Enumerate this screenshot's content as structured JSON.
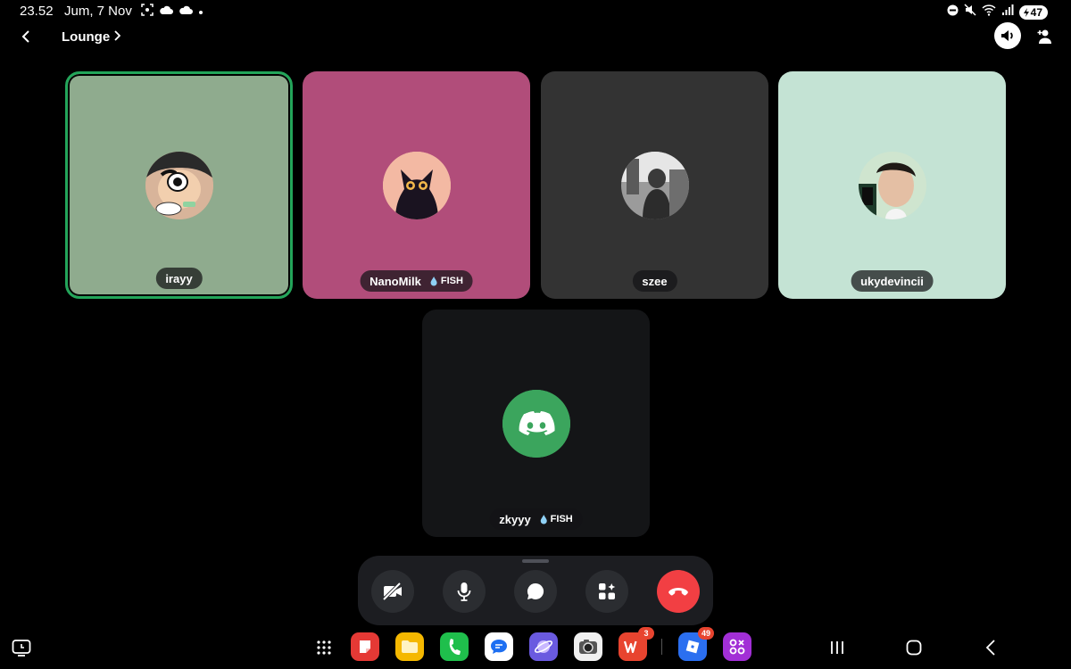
{
  "status_bar": {
    "time": "23.52",
    "date": "Jum, 7 Nov",
    "battery": "47",
    "icons": [
      "screenshot-icon",
      "cloud-icon",
      "cloud-icon",
      "dot-icon",
      "dnd-icon",
      "mute-icon",
      "wifi-icon",
      "signal-icon",
      "battery-icon"
    ]
  },
  "header": {
    "channel": "Lounge"
  },
  "participants": [
    {
      "name": "irayy",
      "tag": "",
      "tile_color": "#8fab8e",
      "speaking": true
    },
    {
      "name": "NanoMilk",
      "tag": "FISH",
      "tile_color": "#b14d7a",
      "speaking": false
    },
    {
      "name": "szee",
      "tag": "",
      "tile_color": "#333333",
      "speaking": false
    },
    {
      "name": "ukydevincii",
      "tag": "",
      "tile_color": "#c4e3d4",
      "speaking": false
    },
    {
      "name": "zkyyy",
      "tag": "FISH",
      "tile_color": "#141517",
      "speaking": false
    }
  ],
  "controls": [
    "camera-off-icon",
    "microphone-icon",
    "chat-icon",
    "activities-icon",
    "end-call-icon"
  ],
  "dock": {
    "apps": [
      {
        "name": "app-red",
        "color": "#e53935",
        "badge": ""
      },
      {
        "name": "app-files",
        "color": "#f5b800",
        "badge": ""
      },
      {
        "name": "app-phone",
        "color": "#1fbf4c",
        "badge": ""
      },
      {
        "name": "app-messages",
        "color": "#ffffff",
        "badge": ""
      },
      {
        "name": "app-browser",
        "color": "#6a5ae0",
        "badge": ""
      },
      {
        "name": "app-camera",
        "color": "#f0f0f0",
        "badge": ""
      },
      {
        "name": "app-wps",
        "color": "#e8442f",
        "badge": "3"
      },
      {
        "name": "app-roblox",
        "color": "#2b6ff0",
        "badge": "49"
      },
      {
        "name": "app-purple",
        "color": "#a22fd6",
        "badge": ""
      }
    ]
  },
  "colors": {
    "speaking_ring": "#23a55a",
    "end_call": "#f23f43",
    "discord_green": "#3ba55d",
    "control_bg": "#2b2d31",
    "bar_bg": "#1c1d21"
  }
}
